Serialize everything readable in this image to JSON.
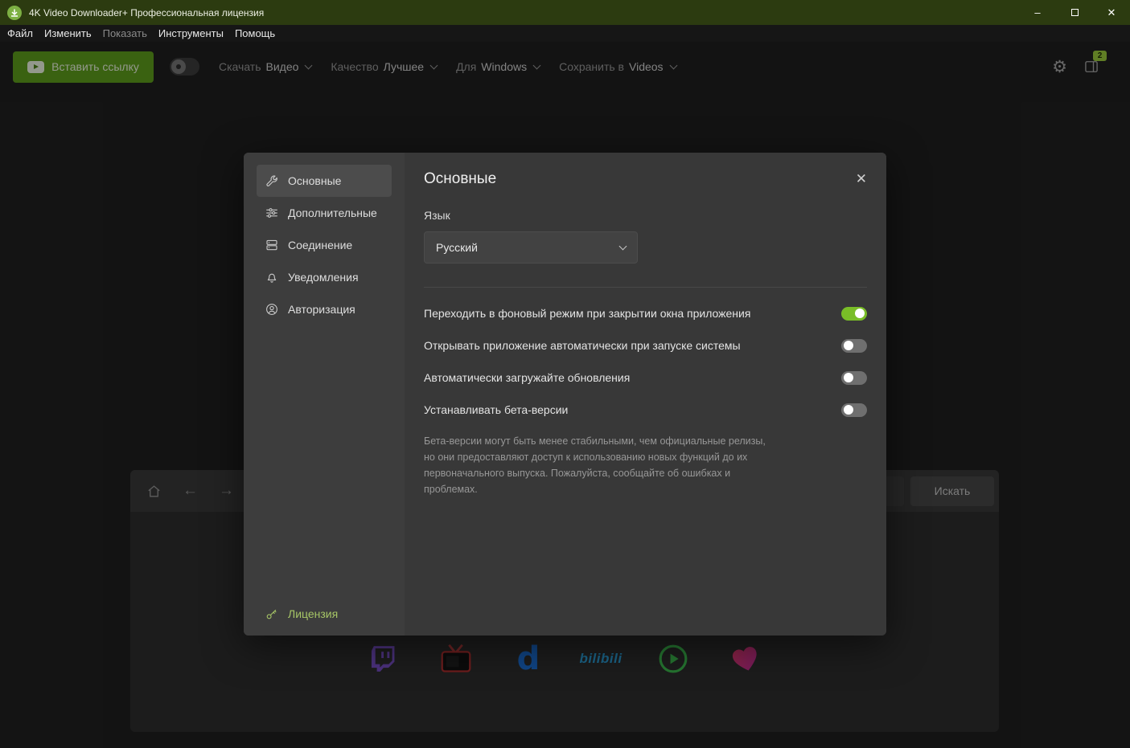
{
  "titlebar": {
    "title": "4K Video Downloader+ Профессиональная лицензия",
    "minimize_glyph": "–",
    "close_glyph": "✕"
  },
  "menubar": {
    "items": [
      {
        "label": "Файл",
        "enabled": true
      },
      {
        "label": "Изменить",
        "enabled": true
      },
      {
        "label": "Показать",
        "enabled": false
      },
      {
        "label": "Инструменты",
        "enabled": true
      },
      {
        "label": "Помощь",
        "enabled": true
      }
    ]
  },
  "toolbar": {
    "paste_link_button": "Вставить ссылку",
    "download": {
      "label": "Скачать",
      "value": "Видео"
    },
    "quality": {
      "label": "Качество",
      "value": "Лучшее"
    },
    "platform": {
      "label": "Для",
      "value": "Windows"
    },
    "save_to": {
      "label": "Сохранить в",
      "value": "Videos"
    },
    "downloads_badge": "2"
  },
  "icons": {
    "gear": "⚙",
    "back_arrow": "←",
    "forward_arrow": "→"
  },
  "browser": {
    "search_button": "Искать"
  },
  "services": {
    "icons": [
      "twitch-icon",
      "retro-tv-icon",
      "dailymotion-icon",
      "bilibili-icon",
      "green-play-icon",
      "likee-heart-icon"
    ],
    "dailymotion_label": "d",
    "bilibili_label": "bilibili"
  },
  "settings_dialog": {
    "header": "Основные",
    "close_glyph": "✕",
    "nav": [
      {
        "label": "Основные",
        "selected": true
      },
      {
        "label": "Дополнительные",
        "selected": false
      },
      {
        "label": "Соединение",
        "selected": false
      },
      {
        "label": "Уведомления",
        "selected": false
      },
      {
        "label": "Авторизация",
        "selected": false
      }
    ],
    "license_label": "Лицензия",
    "language_label": "Язык",
    "language_value": "Русский",
    "toggles": [
      {
        "label": "Переходить в фоновый режим при закрытии окна приложения",
        "on": true
      },
      {
        "label": "Открывать приложение автоматически при запуске системы",
        "on": false
      },
      {
        "label": "Автоматически загружайте обновления",
        "on": false
      },
      {
        "label": "Устанавливать бета-версии",
        "on": false
      }
    ],
    "beta_note": "Бета-версии могут быть менее стабильными, чем официальные релизы, но они предоставляют доступ к использованию новых функций до их первоначального выпуска. Пожалуйста, сообщайте об ошибках и проблемах."
  },
  "colors": {
    "titlebar_green": "#2c3b10",
    "brand_green": "#5e9e1c",
    "accent_green": "#79bd27"
  }
}
